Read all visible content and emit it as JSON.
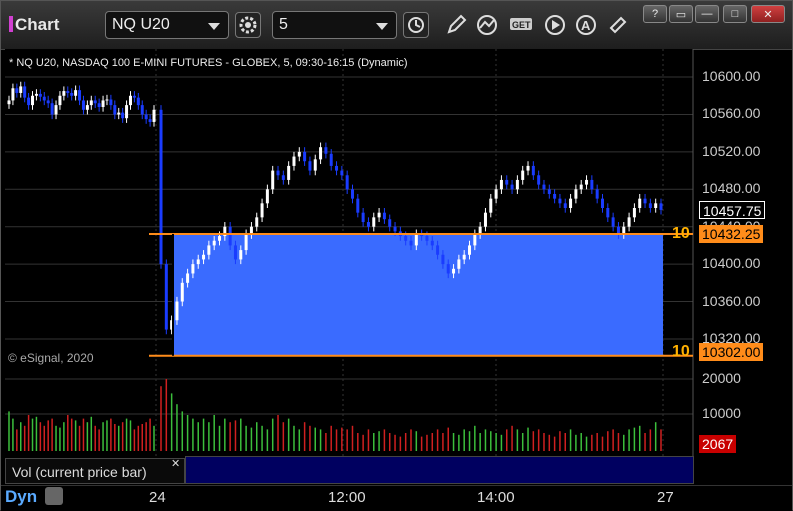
{
  "window": {
    "title": "Chart"
  },
  "toolbar": {
    "symbol": "NQ U20",
    "interval": "5",
    "icons": [
      "settings-gear-icon",
      "clock-icon",
      "pencil-icon",
      "study-icon",
      "get-icon",
      "play-icon",
      "alert-icon",
      "link-icon"
    ]
  },
  "chart": {
    "description": "* NQ U20, NASDAQ 100 E-MINI FUTURES - GLOBEX, 5, 09:30-16:15 (Dynamic)",
    "watermark": "© eSignal, 2020",
    "y_ticks": [
      "10600.00",
      "10560.00",
      "10520.00",
      "10480.00",
      "10440.00",
      "10400.00",
      "10360.00",
      "10320.00"
    ],
    "last_price": "10457.75",
    "upper_level": {
      "size": "10",
      "price": "10432.25"
    },
    "lower_level": {
      "size": "10",
      "price": "10302.00"
    },
    "x_labels": [
      "24",
      "12:00",
      "14:00",
      "27"
    ],
    "colors": {
      "up": "#ffffff",
      "down": "#1a3cff",
      "zone": "#3a6bff",
      "level": "#ff8c1a",
      "vol_up": "#3cbf3c",
      "vol_down": "#d02020"
    }
  },
  "volume": {
    "panel_label": "Vol (current price bar)",
    "y_ticks": [
      "20000",
      "10000"
    ],
    "current": "2067"
  },
  "bottom": {
    "dyn_label": "Dyn"
  },
  "chart_data": {
    "type": "candlestick",
    "title": "NQ U20, NASDAQ 100 E-MINI FUTURES - GLOBEX, 5, 09:30-16:15 (Dynamic)",
    "ylim": [
      10290,
      10630
    ],
    "close": [
      10575,
      10588,
      10583,
      10590,
      10578,
      10570,
      10580,
      10582,
      10579,
      10575,
      10572,
      10560,
      10570,
      10580,
      10585,
      10583,
      10580,
      10586,
      10575,
      10565,
      10570,
      10575,
      10572,
      10568,
      10575,
      10576,
      10570,
      10560,
      10562,
      10556,
      10570,
      10580,
      10578,
      10570,
      10560,
      10555,
      10552,
      10565,
      10400,
      10330,
      10340,
      10360,
      10380,
      10390,
      10400,
      10405,
      10410,
      10420,
      10425,
      10430,
      10440,
      10420,
      10405,
      10415,
      10432,
      10440,
      10450,
      10465,
      10480,
      10500,
      10495,
      10490,
      10505,
      10515,
      10520,
      10510,
      10500,
      10512,
      10525,
      10518,
      10505,
      10500,
      10495,
      10480,
      10470,
      10455,
      10445,
      10440,
      10450,
      10455,
      10448,
      10440,
      10435,
      10430,
      10425,
      10420,
      10432,
      10430,
      10425,
      10420,
      10410,
      10400,
      10390,
      10395,
      10405,
      10410,
      10420,
      10432,
      10440,
      10455,
      10470,
      10480,
      10490,
      10485,
      10480,
      10490,
      10500,
      10505,
      10495,
      10485,
      10480,
      10475,
      10470,
      10465,
      10460,
      10470,
      10480,
      10485,
      10490,
      10480,
      10470,
      10460,
      10450,
      10440,
      10432,
      10440,
      10450,
      10460,
      10470,
      10465,
      10460,
      10465,
      10458
    ],
    "volume": [
      11000,
      9000,
      6000,
      8000,
      7000,
      10000,
      9000,
      9500,
      8000,
      7000,
      8500,
      9000,
      7000,
      6500,
      8000,
      10000,
      9000,
      8500,
      7000,
      9000,
      8000,
      9500,
      7000,
      6000,
      8000,
      8500,
      9000,
      7500,
      7000,
      8000,
      9000,
      8500,
      6000,
      7000,
      7500,
      8000,
      9000,
      7000,
      18000,
      20000,
      16000,
      13000,
      11000,
      10000,
      9000,
      8000,
      9000,
      8000,
      10000,
      7000,
      9000,
      8000,
      8500,
      9000,
      7000,
      6500,
      8000,
      7000,
      6000,
      9000,
      10000,
      8000,
      9000,
      7000,
      6000,
      8000,
      7000,
      6500,
      6000,
      5000,
      7000,
      6000,
      6500,
      6000,
      7000,
      5000,
      4500,
      6000,
      5000,
      5500,
      6000,
      5000,
      4500,
      4000,
      5000,
      6000,
      5500,
      4000,
      4500,
      5000,
      6000,
      5000,
      6500,
      5000,
      4500,
      6000,
      5500,
      7000,
      5000,
      6000,
      5500,
      5000,
      4500,
      6000,
      7000,
      6000,
      5000,
      6500,
      5500,
      6000,
      5000,
      4500,
      4000,
      5500,
      5000,
      6000,
      4500,
      5000,
      4000,
      4500,
      5000,
      4000,
      5500,
      6000,
      5000,
      4500,
      6000,
      6500,
      7000,
      5000,
      6000,
      8000,
      6000,
      4000,
      3000,
      2067
    ],
    "levels": [
      10432.25,
      10302.0
    ]
  }
}
